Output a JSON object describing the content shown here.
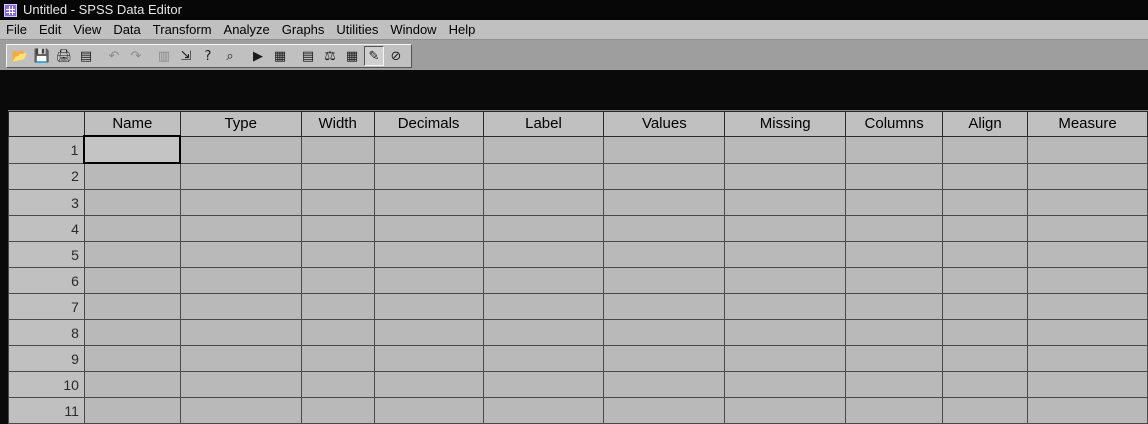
{
  "window": {
    "title": "Untitled - SPSS Data Editor"
  },
  "menu": [
    "File",
    "Edit",
    "View",
    "Data",
    "Transform",
    "Analyze",
    "Graphs",
    "Utilities",
    "Window",
    "Help"
  ],
  "toolbar": [
    {
      "name": "open-file-icon",
      "glyph": "📂",
      "dim": false
    },
    {
      "name": "save-icon",
      "glyph": "💾",
      "dim": false
    },
    {
      "name": "print-icon",
      "glyph": "🖨",
      "dim": false
    },
    {
      "name": "dialog-recall-icon",
      "glyph": "▤",
      "dim": false
    },
    {
      "sep": true
    },
    {
      "name": "undo-icon",
      "glyph": "↶",
      "dim": true
    },
    {
      "name": "redo-icon",
      "glyph": "↷",
      "dim": true
    },
    {
      "sep": true
    },
    {
      "name": "goto-chart-icon",
      "glyph": "▥",
      "dim": true
    },
    {
      "name": "goto-case-icon",
      "glyph": "⇲",
      "dim": false
    },
    {
      "name": "variables-icon",
      "glyph": "?",
      "dim": false
    },
    {
      "name": "find-icon",
      "glyph": "⌕",
      "dim": false
    },
    {
      "sep": true
    },
    {
      "name": "insert-cases-icon",
      "glyph": "▶",
      "dim": false
    },
    {
      "name": "insert-variable-icon",
      "glyph": "▦",
      "dim": false
    },
    {
      "sep": true
    },
    {
      "name": "split-file-icon",
      "glyph": "▤",
      "dim": false
    },
    {
      "name": "weight-cases-icon",
      "glyph": "⚖",
      "dim": false
    },
    {
      "name": "select-cases-icon",
      "glyph": "▦",
      "dim": false
    },
    {
      "name": "value-labels-icon",
      "glyph": "✎",
      "dim": false,
      "pressed": true
    },
    {
      "name": "use-sets-icon",
      "glyph": "⊘",
      "dim": false
    }
  ],
  "grid": {
    "columns": [
      "Name",
      "Type",
      "Width",
      "Decimals",
      "Label",
      "Values",
      "Missing",
      "Columns",
      "Align",
      "Measure"
    ],
    "rows": [
      "1",
      "2",
      "3",
      "4",
      "5",
      "6",
      "7",
      "8",
      "9",
      "10",
      "11"
    ]
  }
}
